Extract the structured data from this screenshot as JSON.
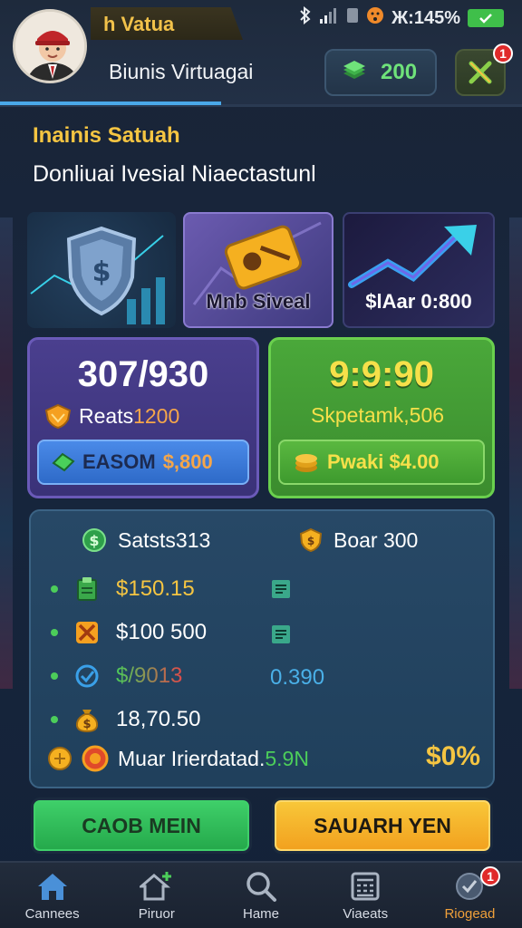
{
  "header": {
    "title_tab": "h Vatua",
    "username": "Biunis  Virtuagai",
    "status_text": "Ж:145%",
    "coins": "200",
    "notif_count": "1"
  },
  "section": {
    "title": "Inainis Satuah",
    "subtitle": "Donliuai Ivesial Niaectastunl"
  },
  "tiles": [
    {
      "label": ""
    },
    {
      "label": "Mnb Siveal"
    },
    {
      "label": "$lAar 0:800"
    }
  ],
  "card_purple": {
    "big": "307/930",
    "row_label": "Reats",
    "row_value": "1200",
    "btn_a": "EASOM",
    "btn_b": "$,800"
  },
  "card_green": {
    "big": "9:9:90",
    "row_label": "Skpetamk,506",
    "btn": "Pwaki $4.00"
  },
  "panel": {
    "head_left": "Satsts313",
    "head_right": "Boar 300",
    "rows": [
      {
        "value": "$150.15",
        "extra": ""
      },
      {
        "value": "$100 500",
        "extra": ""
      },
      {
        "value": "$/9013",
        "extra": "0.390"
      },
      {
        "value": "18,70.50",
        "extra": ""
      }
    ],
    "footer_label": "Muar Irierdatad.",
    "footer_value": "5.9N",
    "percent": "$0%"
  },
  "actions": {
    "left": "CAOB MEIN",
    "right": "SAUARH YEN"
  },
  "nav": [
    {
      "label": "Cannees",
      "icon": "home-icon"
    },
    {
      "label": "Piruor",
      "icon": "house-plus-icon"
    },
    {
      "label": "Hame",
      "icon": "search-icon"
    },
    {
      "label": "Viaeats",
      "icon": "calculator-icon"
    },
    {
      "label": "Riogead",
      "icon": "settings-icon",
      "badge": "1"
    }
  ],
  "colors": {
    "accent_gold": "#f5c542",
    "accent_blue": "#4aa8e8",
    "green": "#4ccd5a",
    "orange": "#f0a03a"
  }
}
